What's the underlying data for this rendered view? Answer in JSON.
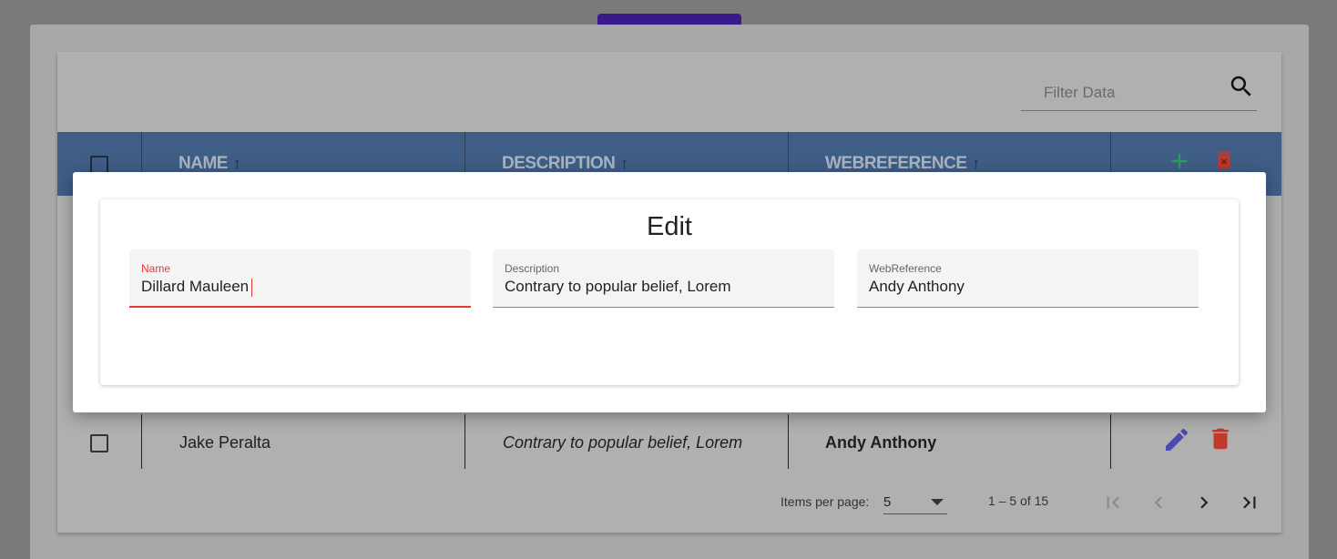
{
  "filter": {
    "placeholder": "Filter Data"
  },
  "table": {
    "columns": [
      {
        "label": "NAME"
      },
      {
        "label": "DESCRIPTION"
      },
      {
        "label": "WEBREFERENCE"
      }
    ],
    "sort_arrow": "↑",
    "visible_row": {
      "name": "Jake Peralta",
      "description": "Contrary to popular belief, Lorem",
      "webreference": "Andy Anthony"
    }
  },
  "paginator": {
    "items_per_page_label": "Items per page:",
    "page_size": "5",
    "range_label": "1 – 5 of 15"
  },
  "dialog": {
    "title": "Edit",
    "fields": [
      {
        "label": "Name",
        "value": "Dillard Mauleen"
      },
      {
        "label": "Description",
        "value": "Contrary to popular belief, Lorem"
      },
      {
        "label": "WebReference",
        "value": "Andy Anthony"
      }
    ]
  },
  "colors": {
    "header_bg": "#3f5e86",
    "add_green": "#2e9e5b",
    "delete_red": "#c0392b",
    "edit_purple": "#4a4ab0",
    "focus_red": "#e53935"
  }
}
